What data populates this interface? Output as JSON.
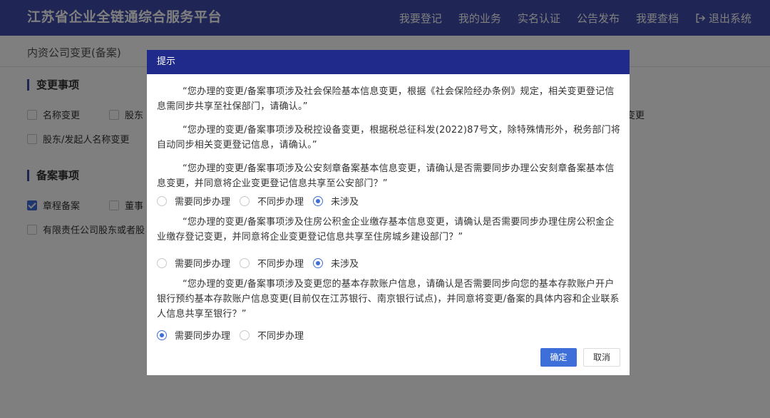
{
  "header": {
    "brand": "江苏省企业全链通综合服务平台",
    "nav": [
      "我要登记",
      "我的业务",
      "实名认证",
      "公告发布",
      "我要查档"
    ],
    "logout": "退出系统"
  },
  "page": {
    "subtitle": "内资公司变更(备案)",
    "change_section": {
      "title": "变更事项",
      "items": [
        {
          "label": "名称变更",
          "checked": false
        },
        {
          "label": "股东",
          "checked": false
        },
        {
          "label": "变更",
          "checked": false
        },
        {
          "label": "股东/发起人名称变更",
          "checked": false
        }
      ]
    },
    "record_section": {
      "title": "备案事项",
      "items": [
        {
          "label": "章程备案",
          "checked": true
        },
        {
          "label": "董事",
          "checked": false
        },
        {
          "label": "有限责任公司股东或者股",
          "checked": false
        }
      ]
    }
  },
  "dialog": {
    "title": "提示",
    "paragraphs": [
      "“您办理的变更/备案事项涉及社会保险基本信息变更，根据《社会保险经办条例》规定，相关变更登记信息需同步共享至社保部门，请确认。”",
      "“您办理的变更/备案事项涉及税控设备变更，根据税总征科发(2022)87号文，除特殊情形外，税务部门将自动同步相关变更登记信息，请确认。”",
      "“您办理的变更/备案事项涉及公安刻章备案基本信息变更，请确认是否需要同步办理公安刻章备案基本信息变更，并同意将企业变更登记信息共享至公安部门？”",
      "“您办理的变更/备案事项涉及住房公积金企业缴存基本信息变更，请确认是否需要同步办理住房公积金企业缴存登记变更，并同意将企业变更登记信息共享至住房城乡建设部门？”",
      "“您办理的变更/备案事项涉及变更您的基本存款账户信息，请确认是否需要同步向您的基本存款账户开户银行预约基本存款账户信息变更(目前仅在江苏银行、南京银行试点)，并同意将变更/备案的具体内容和企业联系人信息共享至银行？”"
    ],
    "radio_groups": [
      {
        "options": [
          "需要同步办理",
          "不同步办理",
          "未涉及"
        ],
        "selected": "未涉及"
      },
      {
        "options": [
          "需要同步办理",
          "不同步办理",
          "未涉及"
        ],
        "selected": "未涉及"
      },
      {
        "options": [
          "需要同步办理",
          "不同步办理"
        ],
        "selected": "需要同步办理"
      }
    ],
    "confirm_label": "确定",
    "cancel_label": "取消"
  },
  "colors": {
    "header_bg": "#3e4aa8",
    "dialog_header_bg": "#1f2a8a",
    "accent": "#3e6fd8"
  }
}
